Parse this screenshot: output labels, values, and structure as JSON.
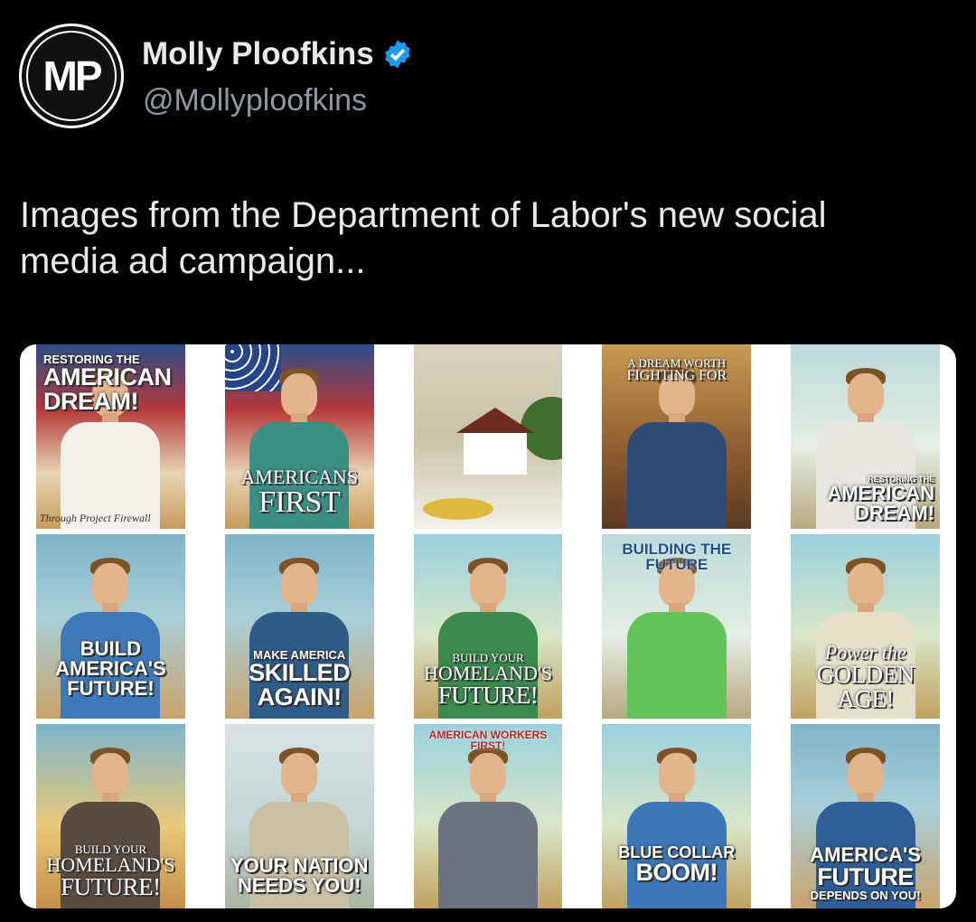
{
  "author": {
    "avatar_initials": "MP",
    "display_name": "Molly Ploofkins",
    "handle": "@Mollyploofkins",
    "verified": true,
    "verified_color": "#1d9bf0"
  },
  "tweet": {
    "text_line1": "Images from the Department of Labor's new social",
    "text_line2": "media ad campaign..."
  },
  "posters": [
    {
      "small": "RESTORING THE",
      "big1": "AMERICAN",
      "big2": "DREAM!",
      "tagline": "Through Project Firewall",
      "shirt": "#ffffff"
    },
    {
      "small": "",
      "big1": "AMERICANS",
      "big2": "FIRST",
      "tagline": "",
      "shirt": "#3b8f83"
    },
    {
      "small": "",
      "big1": "",
      "big2": "",
      "tagline": "",
      "shirt": ""
    },
    {
      "small": "A DREAM WORTH",
      "big1": "FIGHTING FOR",
      "big2": "",
      "tagline": "",
      "shirt": "#2e4b78"
    },
    {
      "small": "RESTORING THE",
      "big1": "AMERICAN",
      "big2": "DREAM!",
      "tagline": "",
      "shirt": "#e8e6df"
    },
    {
      "small": "",
      "big1": "BUILD",
      "big2": "AMERICA'S",
      "big3": "FUTURE!",
      "shirt": "#3f7ab8"
    },
    {
      "small": "MAKE AMERICA",
      "big1": "SKILLED",
      "big2": "AGAIN!",
      "shirt": "#2f5d8a"
    },
    {
      "small": "BUILD YOUR",
      "big1": "HOMELAND'S",
      "big2": "FUTURE!",
      "shirt": "#3b8a4e"
    },
    {
      "small": "",
      "big1": "BUILDING THE FUTURE",
      "big2": "",
      "shirt": "#62c45a"
    },
    {
      "small": "",
      "big1": "Power the",
      "big2": "GOLDEN",
      "big3": "AGE!",
      "shirt": "#e6dfca"
    },
    {
      "small": "BUILD YOUR",
      "big1": "HOMELAND'S",
      "big2": "FUTURE!",
      "shirt": "#5a4b40"
    },
    {
      "small": "",
      "big1": "YOUR NATION",
      "big2": "NEEDS YOU!",
      "shirt": "#c9bfa5"
    },
    {
      "small": "AMERICAN WORKERS FIRST!",
      "big1": "",
      "big2": "",
      "shirt": "#6b7381"
    },
    {
      "small": "",
      "big1": "BLUE COLLAR",
      "big2": "BOOM!",
      "shirt": "#3c78b8"
    },
    {
      "small": "",
      "big1": "AMERICA'S",
      "big2": "FUTURE",
      "big3": "DEPENDS ON YOU!",
      "shirt": "#2f5e9a"
    }
  ]
}
